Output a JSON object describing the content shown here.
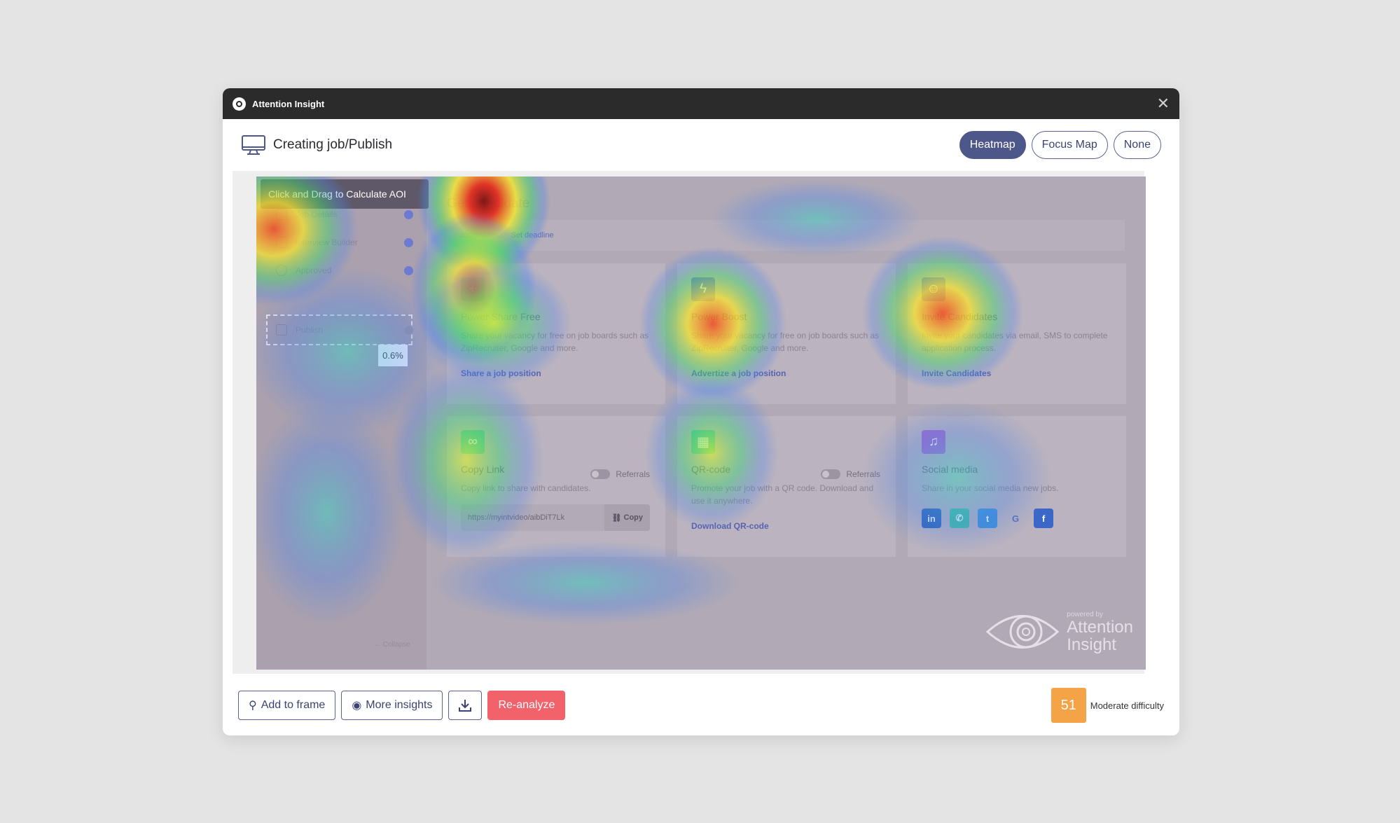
{
  "app": {
    "title": "Attention Insight"
  },
  "header": {
    "page_title": "Creating job/Publish"
  },
  "view_toggle": {
    "heatmap": "Heatmap",
    "focus_map": "Focus Map",
    "none": "None"
  },
  "preview": {
    "aoi_tip": "Click and Drag to Calculate AOI",
    "aoi_percent": "0.6%",
    "steps": [
      {
        "label": "Job Details"
      },
      {
        "label": "Interview Builder"
      },
      {
        "label": "Approved"
      },
      {
        "label": "Publish"
      }
    ],
    "collapse": "← Collapse",
    "page_title": "Get candidate",
    "deadline": {
      "label": "Job deadline:",
      "link": "Set deadline"
    },
    "cards": [
      {
        "title": "Power Share Free",
        "desc": "Share your vacancy for free on job boards such as ZipRecruiter, Google and more.",
        "link": "Share a job position",
        "icon": "plus-icon",
        "color": "#3fbfa0"
      },
      {
        "title": "Power Boost",
        "desc": "Share your vacancy for free on job boards such as ZipRecruiter, Google and more.",
        "link": "Advertize a job position",
        "icon": "bolt-icon",
        "color": "#6c6ad1"
      },
      {
        "title": "Invite Candidates",
        "desc": "Invite your candidates via email, SMS to complete application process.",
        "link": "Invite Candidates",
        "icon": "users-icon",
        "color": "#6c6ad1"
      },
      {
        "title": "Copy Link",
        "desc": "Copy link to share with candidates.",
        "toggle": "Referrals",
        "url": "https://myintvideo/aibDiT7Lk",
        "copy": "Copy",
        "icon": "link-icon",
        "color": "#3fbfa0"
      },
      {
        "title": "QR-code",
        "desc": "Promote your job with a QR code. Download and use it anywhere.",
        "toggle": "Referrals",
        "link": "Download QR-code",
        "icon": "qr-icon",
        "color": "#3fbfa0"
      },
      {
        "title": "Social media",
        "desc": "Share in your social media new jobs.",
        "icon": "bell-icon",
        "color": "#a26acb"
      }
    ],
    "socials": [
      {
        "icon": "linkedin-icon",
        "glyph": "in",
        "color": "#2f66b8"
      },
      {
        "icon": "whatsapp-icon",
        "glyph": "✆",
        "color": "#3fbfa0"
      },
      {
        "icon": "twitter-icon",
        "glyph": "t",
        "color": "#3d8fd8"
      },
      {
        "icon": "google-icon",
        "glyph": "G",
        "color": "transparent"
      },
      {
        "icon": "facebook-icon",
        "glyph": "f",
        "color": "#3b67c8"
      }
    ],
    "watermark": {
      "small": "powered by",
      "line1": "Attention",
      "line2": "Insight"
    }
  },
  "footer": {
    "add_to_frame": "Add to frame",
    "more_insights": "More insights",
    "reanalyze": "Re-analyze",
    "score": "51",
    "difficulty": "Moderate difficulty"
  },
  "colors": {
    "accent": "#4e5789",
    "primary_action": "#f1626a",
    "score_badge": "#f4a347"
  }
}
